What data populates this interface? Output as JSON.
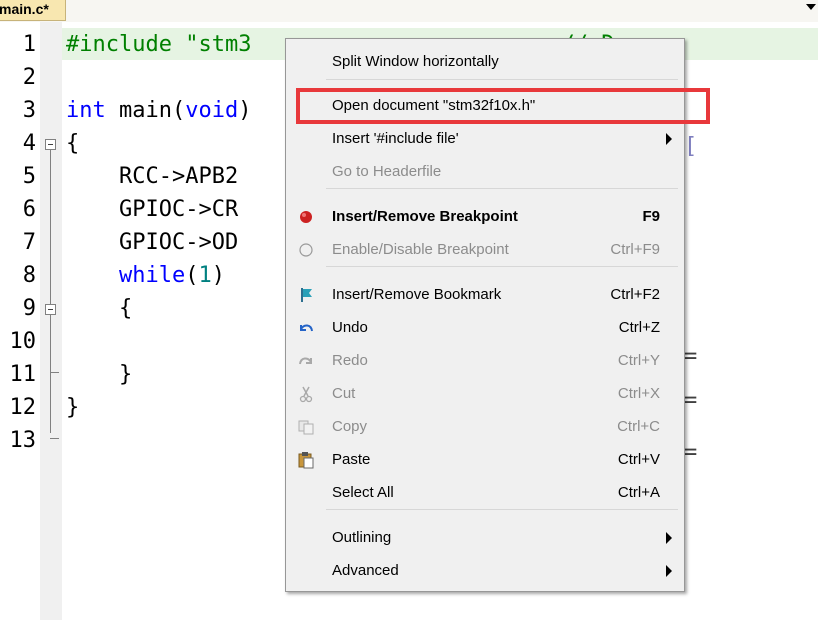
{
  "tab": {
    "label": "main.c*"
  },
  "editor": {
    "line_numbers": [
      "1",
      "2",
      "3",
      "4",
      "5",
      "6",
      "7",
      "8",
      "9",
      "10",
      "11",
      "12",
      "13"
    ],
    "line1": {
      "directive": "#include",
      "file": "\"stm3",
      "comment": "// Dev"
    },
    "line3": {
      "kw_int": "int",
      "main": " main(",
      "kw_void": "void",
      "close": ")"
    },
    "line4": "{",
    "line5": "    RCC->APB2",
    "line6": "    GPIOC->CR",
    "line7": "    GPIOC->OD",
    "line8": {
      "indent": "    ",
      "kw_while": "while",
      "open": "(",
      "num": "1",
      "close": ")"
    },
    "line9": "    {",
    "line11": "    }",
    "line12": "}"
  },
  "context_menu": {
    "items": [
      {
        "label": "Split Window horizontally",
        "shortcut": "",
        "icon": "",
        "disabled": false,
        "bold": false,
        "submenu": false
      },
      {
        "label": "Open document \"stm32f10x.h\"",
        "shortcut": "",
        "icon": "",
        "disabled": false,
        "bold": false,
        "submenu": false
      },
      {
        "label": "Insert '#include file'",
        "shortcut": "",
        "icon": "",
        "disabled": false,
        "bold": false,
        "submenu": true
      },
      {
        "label": "Go to Headerfile",
        "shortcut": "",
        "icon": "",
        "disabled": true,
        "bold": false,
        "submenu": false
      },
      {
        "label": "Insert/Remove Breakpoint",
        "shortcut": "F9",
        "icon": "breakpoint-icon",
        "disabled": false,
        "bold": true,
        "submenu": false
      },
      {
        "label": "Enable/Disable Breakpoint",
        "shortcut": "Ctrl+F9",
        "icon": "breakpoint-disabled-icon",
        "disabled": true,
        "bold": false,
        "submenu": false
      },
      {
        "label": "Insert/Remove Bookmark",
        "shortcut": "Ctrl+F2",
        "icon": "bookmark-icon",
        "disabled": false,
        "bold": false,
        "submenu": false
      },
      {
        "label": "Undo",
        "shortcut": "Ctrl+Z",
        "icon": "undo-icon",
        "disabled": false,
        "bold": false,
        "submenu": false
      },
      {
        "label": "Redo",
        "shortcut": "Ctrl+Y",
        "icon": "redo-icon",
        "disabled": true,
        "bold": false,
        "submenu": false
      },
      {
        "label": "Cut",
        "shortcut": "Ctrl+X",
        "icon": "cut-icon",
        "disabled": true,
        "bold": false,
        "submenu": false
      },
      {
        "label": "Copy",
        "shortcut": "Ctrl+C",
        "icon": "copy-icon",
        "disabled": true,
        "bold": false,
        "submenu": false
      },
      {
        "label": "Paste",
        "shortcut": "Ctrl+V",
        "icon": "paste-icon",
        "disabled": false,
        "bold": false,
        "submenu": false
      },
      {
        "label": "Select All",
        "shortcut": "Ctrl+A",
        "icon": "",
        "disabled": false,
        "bold": false,
        "submenu": false
      },
      {
        "label": "Outlining",
        "shortcut": "",
        "icon": "",
        "disabled": false,
        "bold": false,
        "submenu": true
      },
      {
        "label": "Advanced",
        "shortcut": "",
        "icon": "",
        "disabled": false,
        "bold": false,
        "submenu": true
      }
    ]
  },
  "colors": {
    "accent_highlight": "#e8383b",
    "breakpoint": "#cc2222",
    "keyword": "#0000ff",
    "preprocessor": "#008000"
  }
}
